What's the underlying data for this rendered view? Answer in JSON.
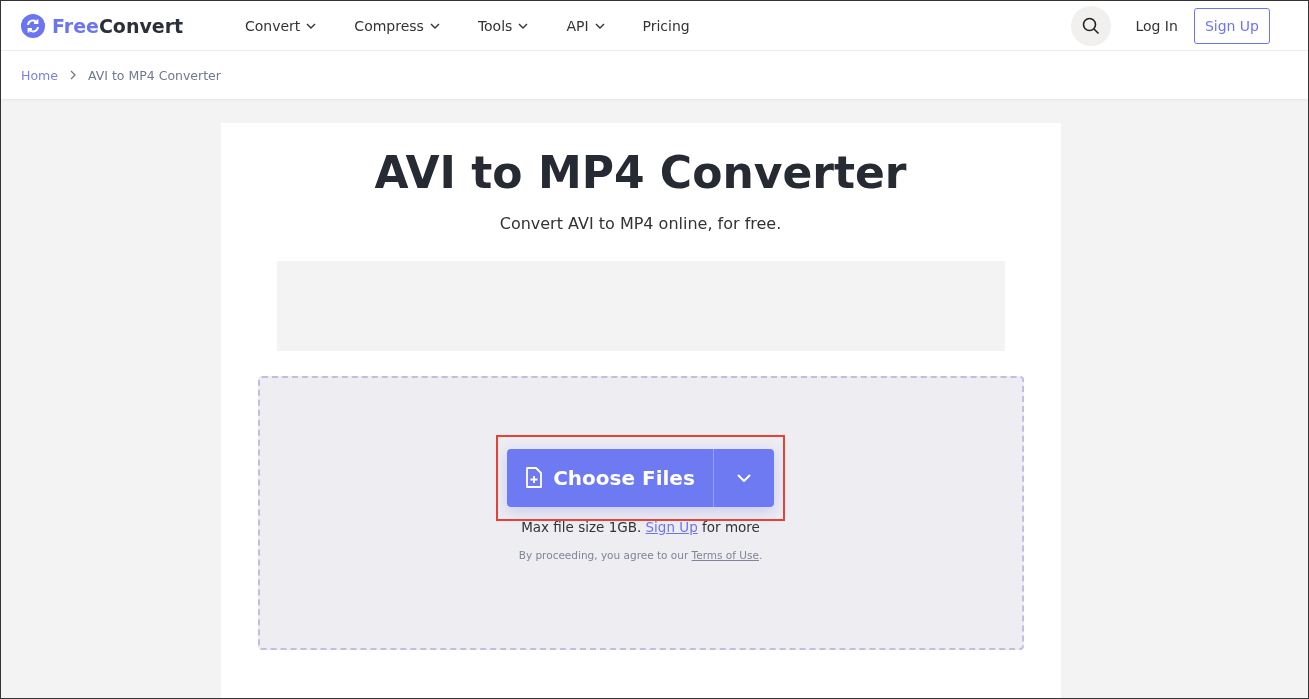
{
  "logo": {
    "part_1": "Free",
    "part_2": "Convert"
  },
  "nav": [
    {
      "label": "Convert",
      "dropdown": true
    },
    {
      "label": "Compress",
      "dropdown": true
    },
    {
      "label": "Tools",
      "dropdown": true
    },
    {
      "label": "API",
      "dropdown": true
    },
    {
      "label": "Pricing",
      "dropdown": false
    }
  ],
  "login": "Log In",
  "signup": "Sign Up",
  "breadcrumb": [
    "Home",
    "AVI to MP4 Converter"
  ],
  "title": "AVI to MP4 Converter",
  "subtitle": "Convert AVI to MP4 online, for free.",
  "upload": {
    "button": "Choose Files",
    "highlighted": true,
    "limit": {
      "before": "Max file size 1GB. ",
      "link": "Sign Up",
      "after": " for more"
    },
    "terms": {
      "before": "By proceeding, you agree to our ",
      "link": "Terms of Use",
      "after": "."
    }
  }
}
